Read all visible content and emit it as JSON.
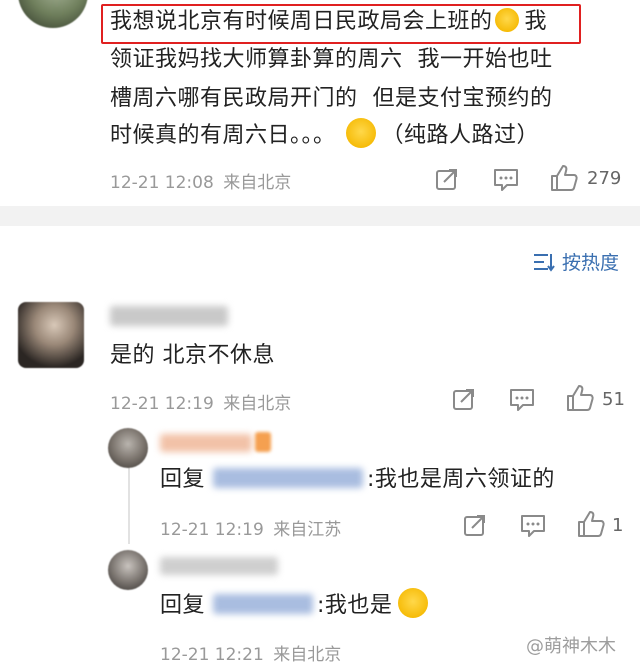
{
  "top_comment": {
    "lines": [
      "我想说北京有时候周日民政局会上班的",
      "领证我妈找大师算卦算的周六  我一开始也吐",
      "槽周六哪有民政局开门的  但是支付宝预约的",
      "时候真的有周六日。。。"
    ],
    "line1_tail": "我",
    "line4_tail": "（纯路人路过）",
    "time": "12-21 12:08",
    "location": "来自北京",
    "likes": "279"
  },
  "sort": {
    "label": "按热度"
  },
  "reply1": {
    "text": "是的 北京不休息",
    "time": "12-21 12:19",
    "location": "来自北京",
    "likes": "51"
  },
  "sub1": {
    "prefix": "回复",
    "text": ":我也是周六领证的",
    "time": "12-21 12:19",
    "location": "来自江苏",
    "likes": "1"
  },
  "sub2": {
    "prefix": "回复",
    "text": ":我也是",
    "time": "12-21 12:21",
    "location": "来自北京"
  },
  "watermark": "@萌神木木",
  "colors": {
    "accent": "#e02020",
    "sort_blue": "#3a6fb0",
    "meta_gray": "#999999"
  }
}
